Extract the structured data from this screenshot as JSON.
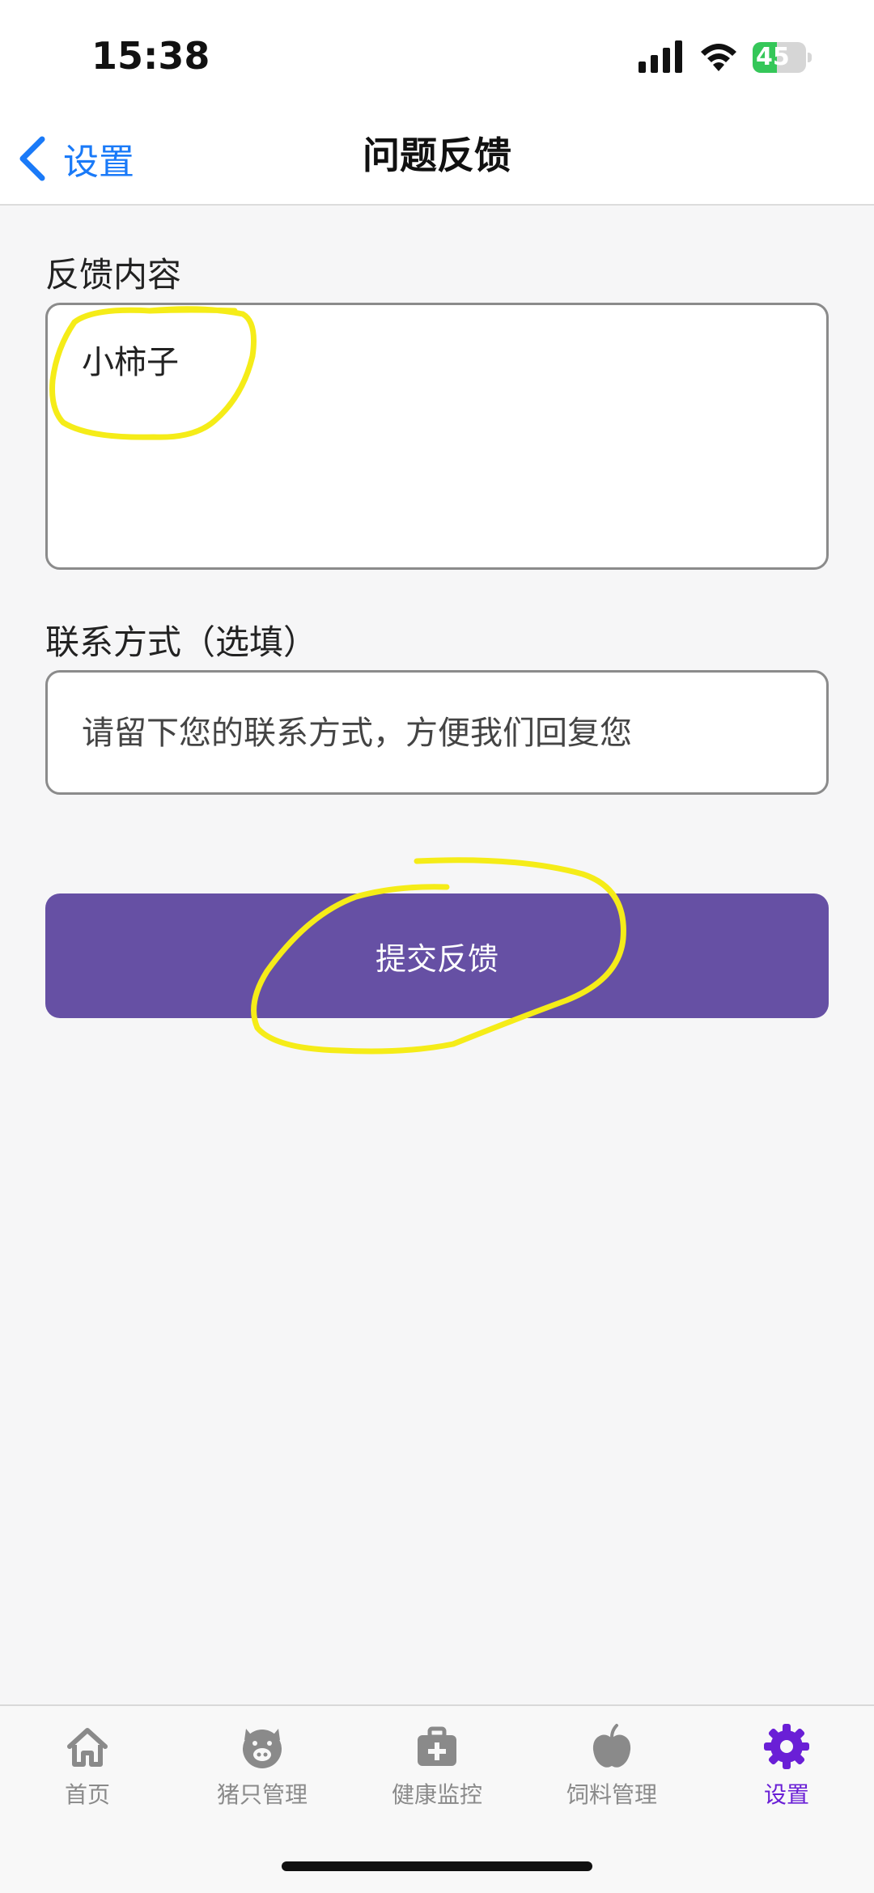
{
  "status_bar": {
    "time": "15:38",
    "battery": "45",
    "battery_percent": 45
  },
  "nav": {
    "back_label": "设置",
    "title": "问题反馈"
  },
  "form": {
    "feedback_label": "反馈内容",
    "feedback_value": "小柿子",
    "contact_label": "联系方式（选填）",
    "contact_placeholder": "请留下您的联系方式，方便我们回复您",
    "submit_label": "提交反馈"
  },
  "tabs": [
    {
      "label": "首页",
      "icon": "home-icon"
    },
    {
      "label": "猪只管理",
      "icon": "pig-icon"
    },
    {
      "label": "健康监控",
      "icon": "medical-kit-icon"
    },
    {
      "label": "饲料管理",
      "icon": "apple-icon"
    },
    {
      "label": "设置",
      "icon": "gear-icon",
      "active": true
    }
  ],
  "colors": {
    "accent": "#1a7af8",
    "button": "#6650a4",
    "active_tab": "#6a1fd6",
    "highlight": "#f5ec18"
  }
}
